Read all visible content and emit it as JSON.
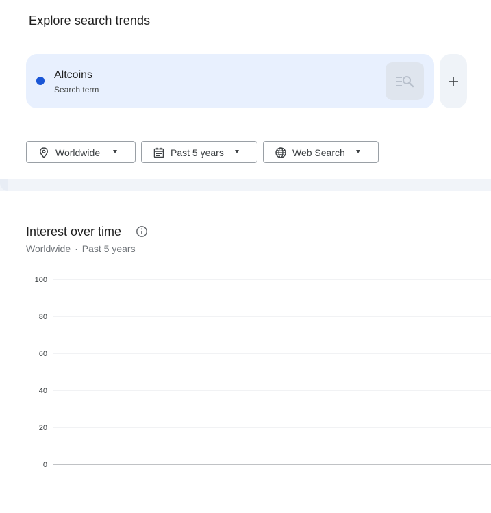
{
  "header": {
    "title": "Explore search trends"
  },
  "term": {
    "name": "Altcoins",
    "type": "Search term",
    "color": "#1a56d6"
  },
  "add_button": {
    "label": "+"
  },
  "filters": {
    "location": "Worldwide",
    "time_range": "Past 5 years",
    "property": "Web Search"
  },
  "chart": {
    "title": "Interest over time",
    "subtitle_location": "Worldwide",
    "subtitle_separator": "·",
    "subtitle_time": "Past 5 years"
  },
  "chart_data": {
    "type": "line",
    "title": "Interest over time",
    "xlabel": "",
    "ylabel": "",
    "ylim": [
      0,
      100
    ],
    "yticks": [
      100,
      80,
      60,
      40,
      20,
      0
    ],
    "grid": true,
    "series": []
  }
}
